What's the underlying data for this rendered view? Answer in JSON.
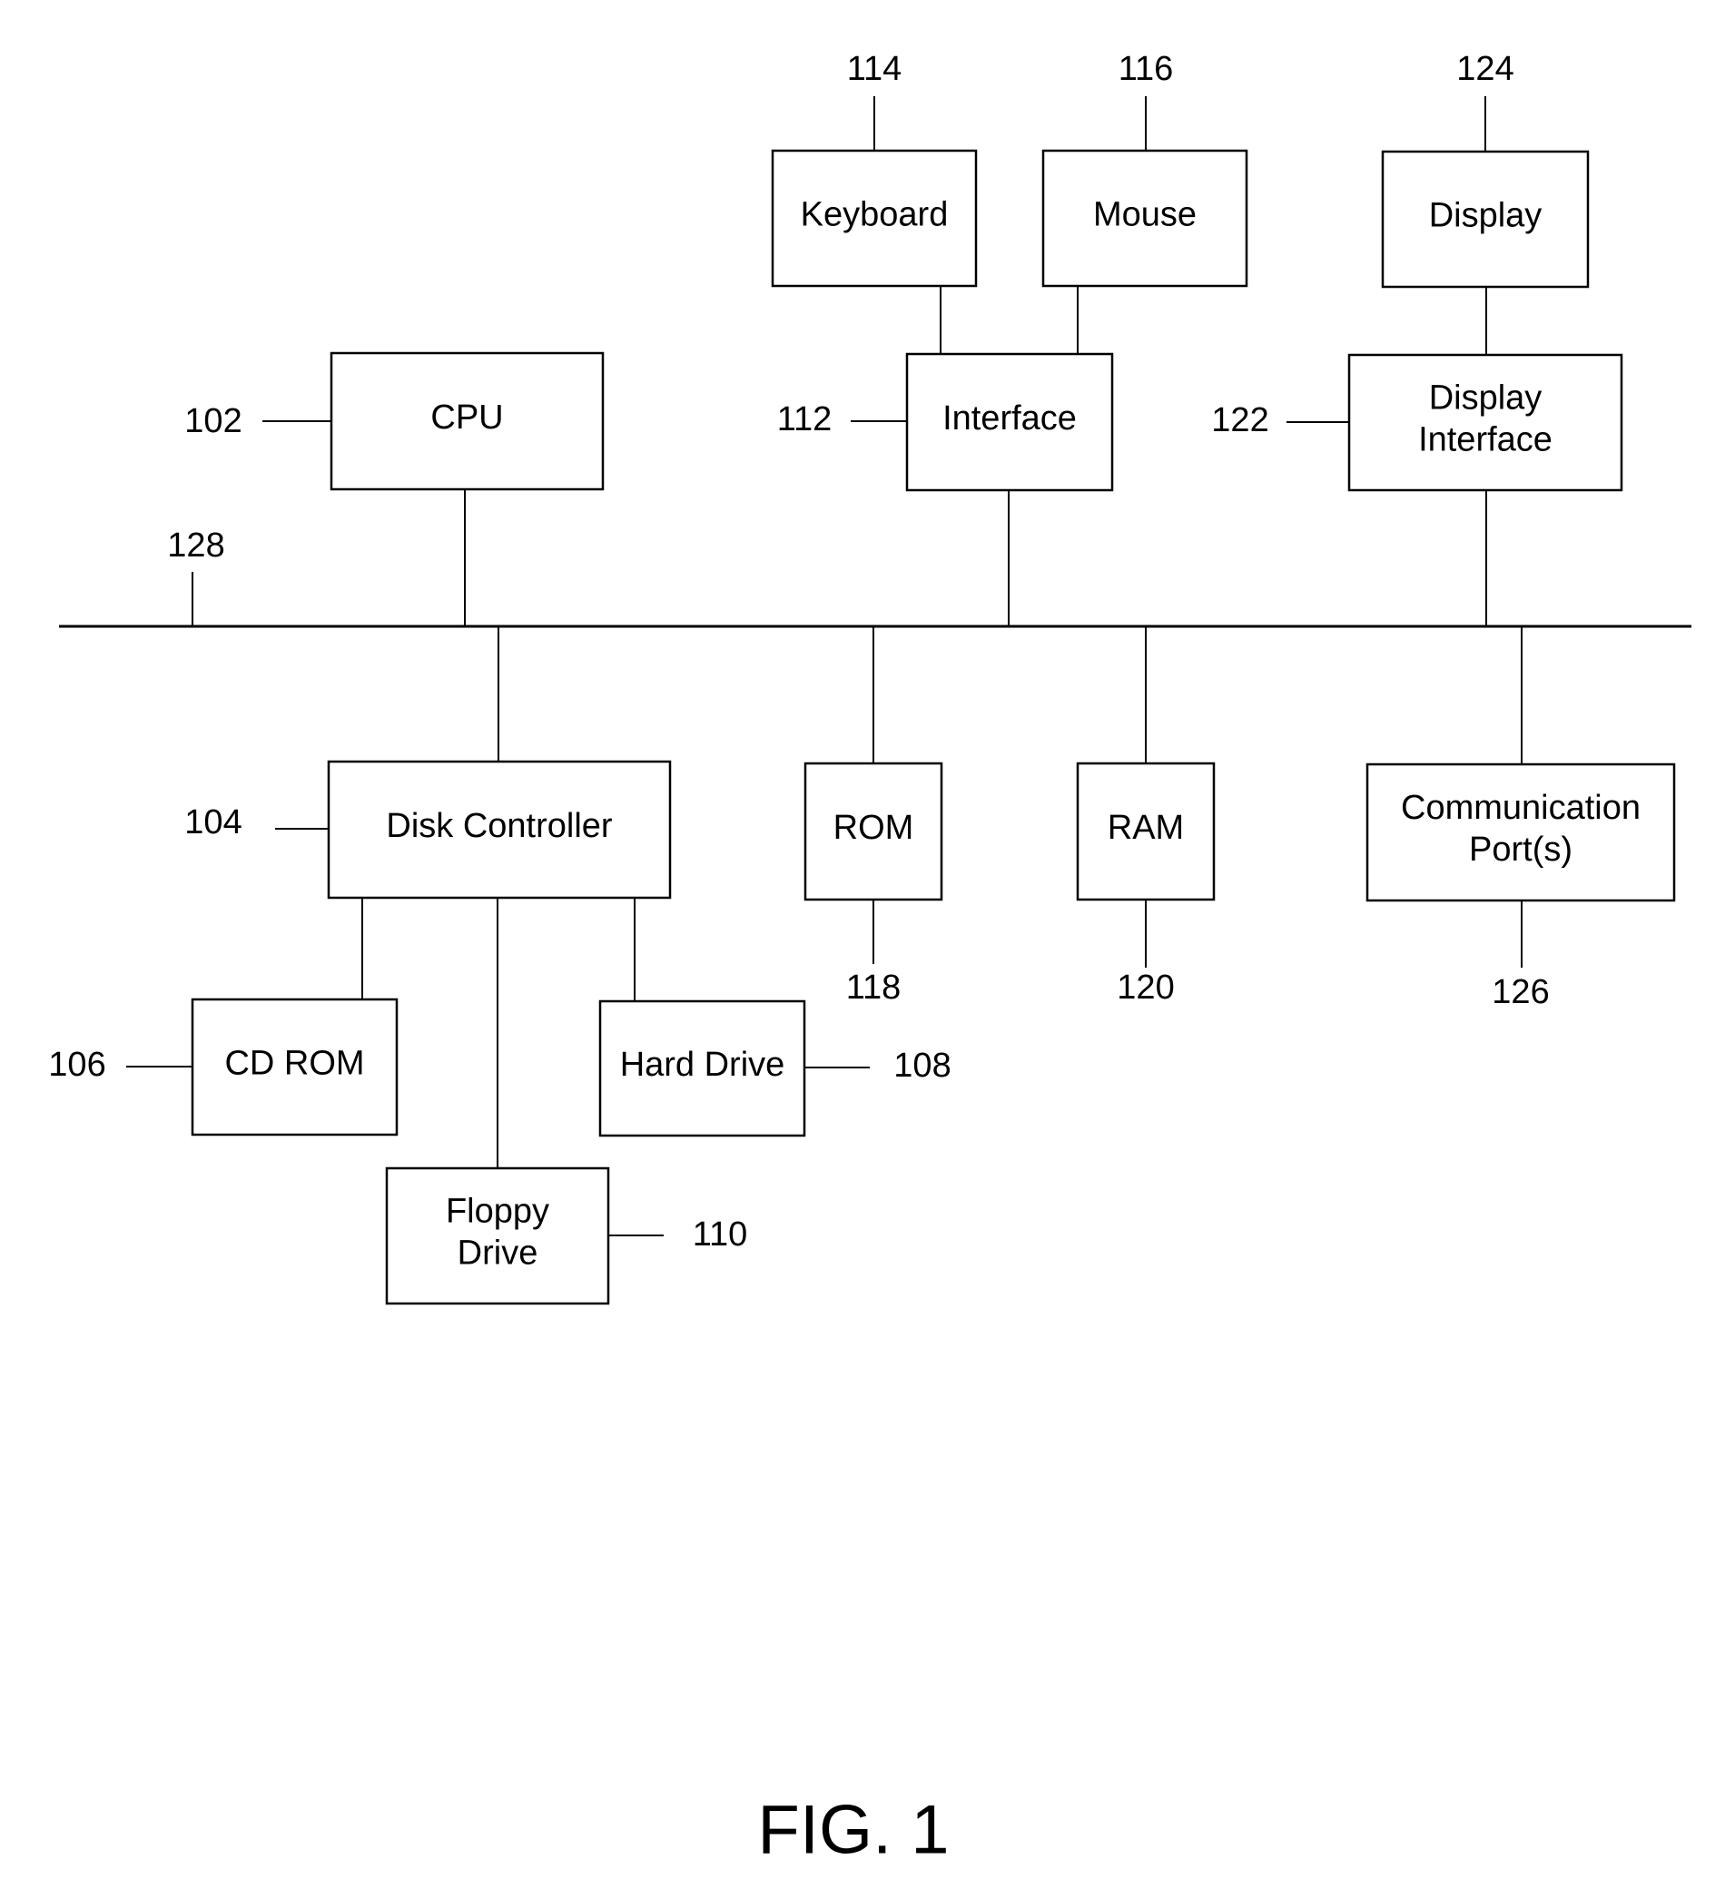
{
  "figure": {
    "caption": "FIG. 1"
  },
  "bus": {
    "ref": "128"
  },
  "components": {
    "cpu": {
      "lines": [
        "CPU"
      ],
      "ref": "102"
    },
    "disk_controller": {
      "lines": [
        "Disk Controller"
      ],
      "ref": "104"
    },
    "cd_rom": {
      "lines": [
        "CD ROM"
      ],
      "ref": "106"
    },
    "hard_drive": {
      "lines": [
        "Hard Drive"
      ],
      "ref": "108"
    },
    "floppy_drive": {
      "lines": [
        "Floppy",
        "Drive"
      ],
      "ref": "110"
    },
    "interface": {
      "lines": [
        "Interface"
      ],
      "ref": "112"
    },
    "keyboard": {
      "lines": [
        "Keyboard"
      ],
      "ref": "114"
    },
    "mouse": {
      "lines": [
        "Mouse"
      ],
      "ref": "116"
    },
    "rom": {
      "lines": [
        "ROM"
      ],
      "ref": "118"
    },
    "ram": {
      "lines": [
        "RAM"
      ],
      "ref": "120"
    },
    "display_interface": {
      "lines": [
        "Display",
        "Interface"
      ],
      "ref": "122"
    },
    "display": {
      "lines": [
        "Display"
      ],
      "ref": "124"
    },
    "communication_ports": {
      "lines": [
        "Communication",
        "Port(s)"
      ],
      "ref": "126"
    }
  }
}
